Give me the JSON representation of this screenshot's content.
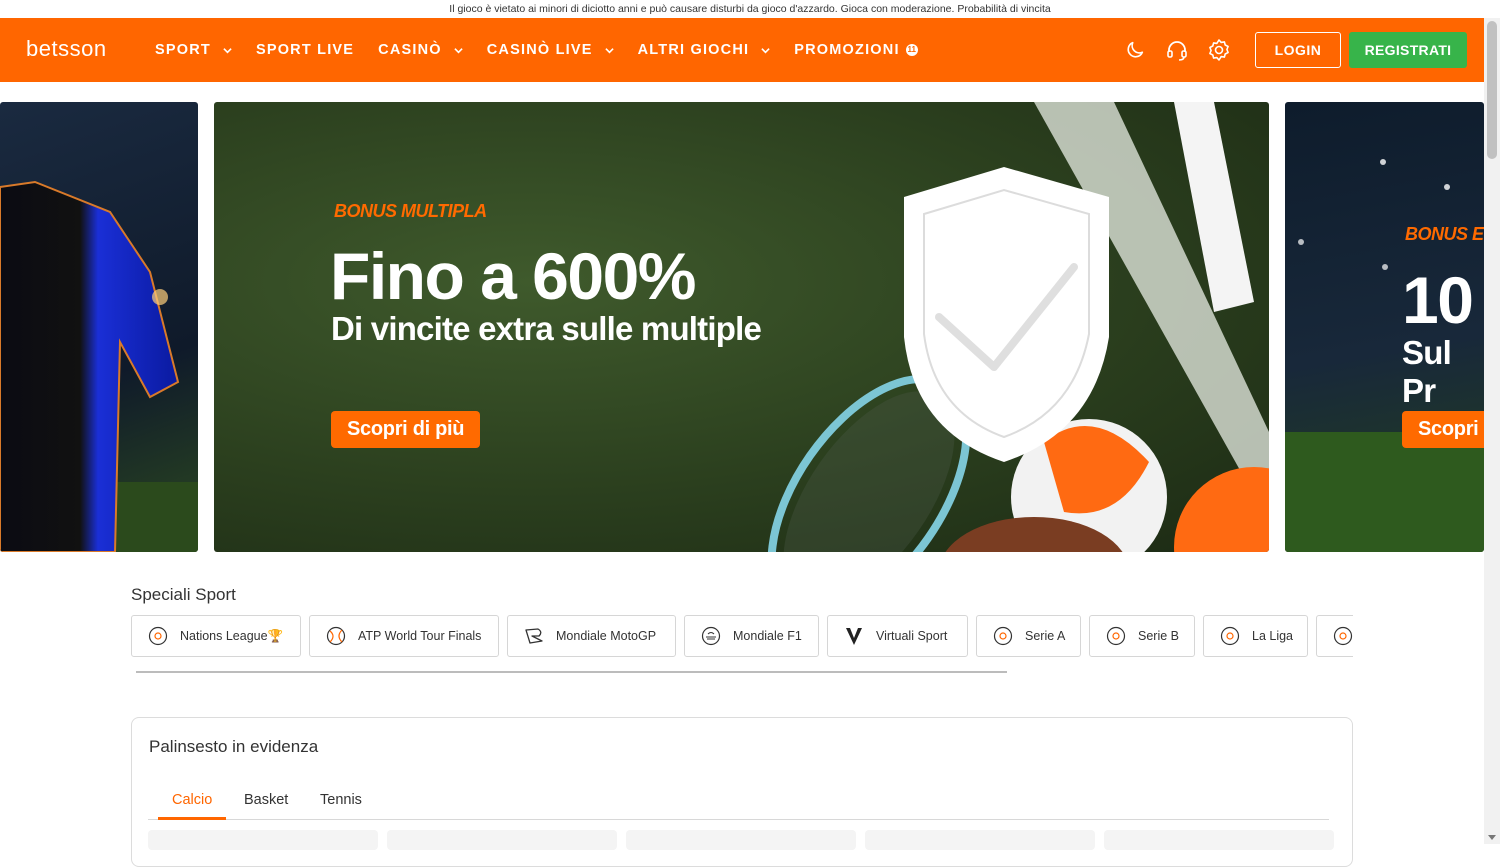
{
  "disclaimer": "Il gioco è vietato ai minori di diciotto anni e può causare disturbi da gioco d'azzardo. Gioca con moderazione. Probabilità di vincita",
  "brand": {
    "logo": "betsson",
    "accent": "#ff6600",
    "register_color": "#37b44a"
  },
  "nav": {
    "items": [
      {
        "label": "SPORT"
      },
      {
        "label": "SPORT LIVE"
      },
      {
        "label": "CASINÒ"
      },
      {
        "label": "CASINÒ LIVE"
      },
      {
        "label": "ALTRI GIOCHI"
      },
      {
        "label": "PROMOZIONI",
        "badge": "11"
      }
    ]
  },
  "header_icons": [
    "moon-icon",
    "headset-icon",
    "settings-icon"
  ],
  "auth": {
    "login_label": "LOGIN",
    "register_label": "REGISTRATI"
  },
  "hero": {
    "main": {
      "tag": "BONUS MULTIPLA",
      "headline": "Fino a 600%",
      "subline": "Di vincite extra sulle multiple",
      "cta": "Scopri di più"
    },
    "next": {
      "tag": "BONUS E",
      "headline": "10",
      "subline": "Sul Pr",
      "cta": "Scopri"
    }
  },
  "speciali": {
    "title": "Speciali Sport",
    "chips": [
      {
        "label": "Nations League🏆",
        "icon": "football-icon"
      },
      {
        "label": "ATP World Tour Finals",
        "icon": "tennis-icon"
      },
      {
        "label": "Mondiale MotoGP",
        "icon": "motorbike-icon"
      },
      {
        "label": "Mondiale F1",
        "icon": "f1-icon"
      },
      {
        "label": "Virtuali Sport",
        "icon": "virtual-icon"
      },
      {
        "label": "Serie A",
        "icon": "football-icon"
      },
      {
        "label": "Serie B",
        "icon": "football-icon"
      },
      {
        "label": "La Liga",
        "icon": "football-icon"
      },
      {
        "label": "",
        "icon": "football-icon"
      }
    ]
  },
  "palinsesto": {
    "title": "Palinsesto in evidenza",
    "tabs": [
      {
        "label": "Calcio",
        "active": true
      },
      {
        "label": "Basket",
        "active": false
      },
      {
        "label": "Tennis",
        "active": false
      }
    ]
  }
}
